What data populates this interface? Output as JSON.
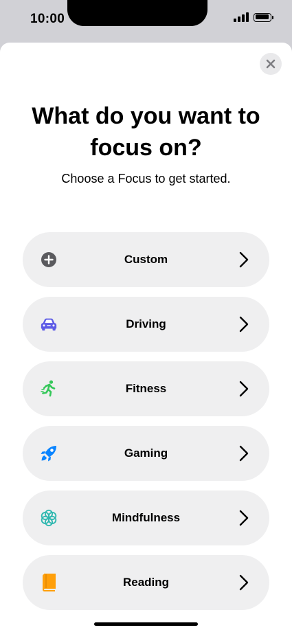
{
  "status_bar": {
    "time": "10:00",
    "signal_icon": "cellular-signal-icon",
    "battery_icon": "battery-icon"
  },
  "sheet": {
    "close_icon": "close-icon",
    "title": "What do you want to focus on?",
    "subtitle": "Choose a Focus to get started."
  },
  "options": [
    {
      "label": "Custom",
      "icon": "plus-circle-icon",
      "color": "#5a5a5e"
    },
    {
      "label": "Driving",
      "icon": "car-icon",
      "color": "#5e5ce6"
    },
    {
      "label": "Fitness",
      "icon": "running-icon",
      "color": "#34c759"
    },
    {
      "label": "Gaming",
      "icon": "rocket-icon",
      "color": "#0a84ff"
    },
    {
      "label": "Mindfulness",
      "icon": "flower-icon",
      "color": "#30b8b0"
    },
    {
      "label": "Reading",
      "icon": "book-icon",
      "color": "#ff9f0a"
    }
  ],
  "chevron_icon": "chevron-right-icon"
}
